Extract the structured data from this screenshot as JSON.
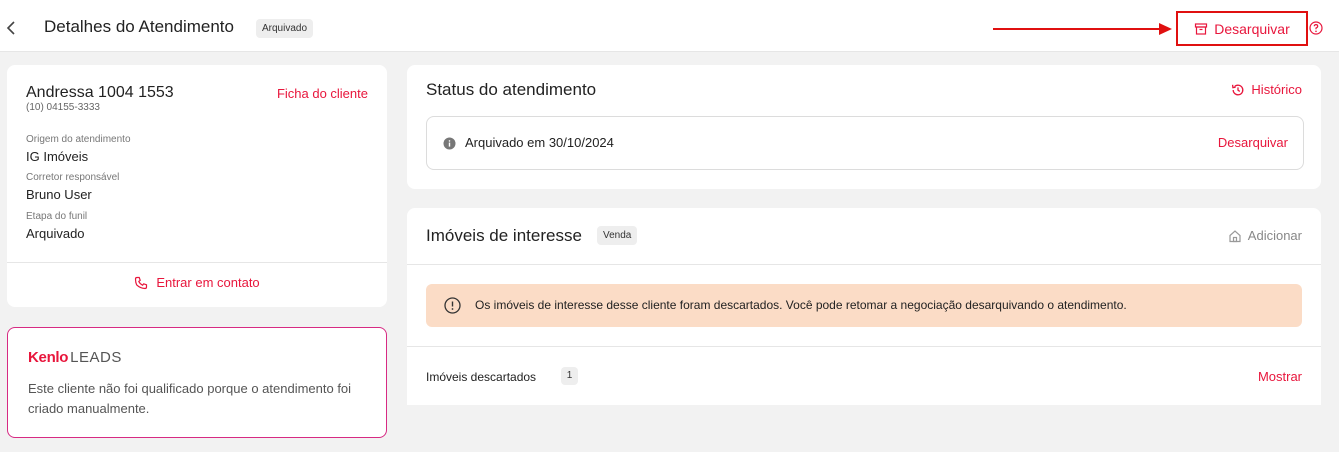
{
  "header": {
    "title": "Detalhes do Atendimento",
    "badge": "Arquivado",
    "unarchive_label": "Desarquivar"
  },
  "client": {
    "name": "Andressa 1004 1553",
    "phone": "(10) 04155-3333",
    "profile_link": "Ficha do cliente",
    "fields": [
      {
        "label": "Origem do atendimento",
        "value": "IG Imóveis"
      },
      {
        "label": "Corretor responsável",
        "value": "Bruno User"
      },
      {
        "label": "Etapa do funil",
        "value": "Arquivado"
      }
    ],
    "contact_label": "Entrar em contato"
  },
  "kenlo": {
    "logo_brand": "Kenlo",
    "logo_product": "LEADS",
    "text": "Este cliente não foi qualificado porque o atendimento foi criado manualmente."
  },
  "status": {
    "title": "Status do atendimento",
    "history_label": "Histórico",
    "message": "Arquivado em 30/10/2024",
    "action_label": "Desarquivar"
  },
  "properties": {
    "title": "Imóveis de interesse",
    "badge": "Venda",
    "add_label": "Adicionar",
    "alert": "Os imóveis de interesse desse cliente foram descartados. Você pode retomar a negociação desarquivando o atendimento.",
    "discarded_label": "Imóveis descartados",
    "discarded_count": "1",
    "show_label": "Mostrar"
  },
  "colors": {
    "accent": "#e8163c",
    "highlight_box": "#e01010",
    "alert_bg": "#fbdcc6",
    "kenlo_border": "#d72a83"
  },
  "icons": [
    "chevron-left-icon",
    "arrow-right-icon",
    "archive-icon",
    "help-icon",
    "phone-icon",
    "history-icon",
    "info-icon",
    "home-icon",
    "alert-circle-icon"
  ]
}
